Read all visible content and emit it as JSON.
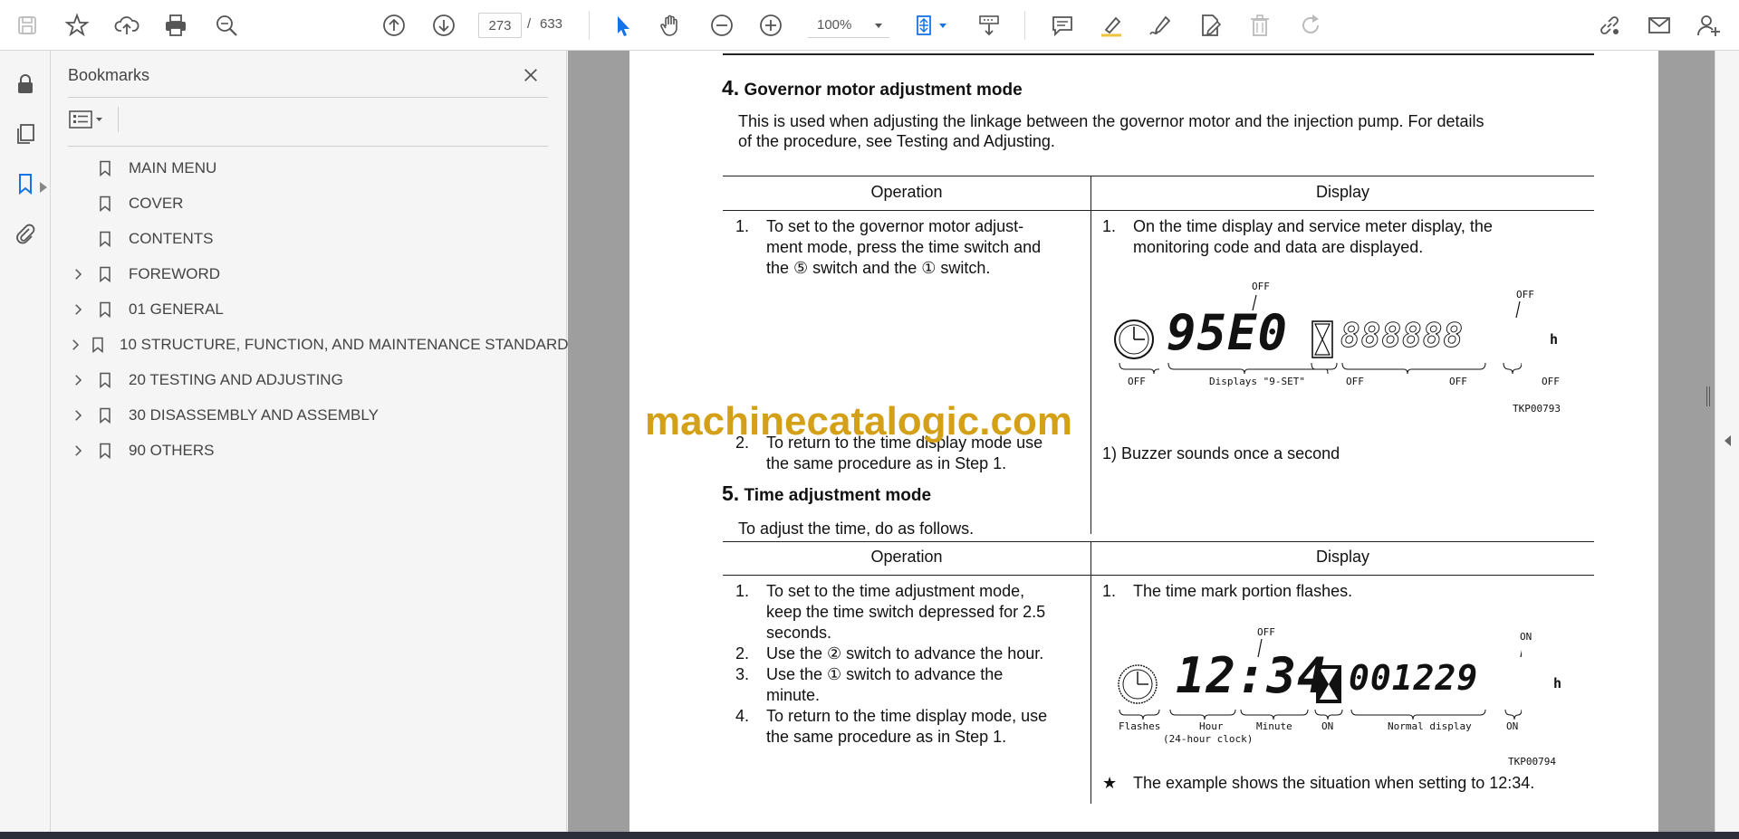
{
  "toolbar": {
    "page_current": "273",
    "page_separator": "/",
    "page_total": "633",
    "zoom": "100%"
  },
  "bookmarks": {
    "title": "Bookmarks",
    "items": [
      {
        "label": "MAIN MENU",
        "expandable": false
      },
      {
        "label": "COVER",
        "expandable": false
      },
      {
        "label": "CONTENTS",
        "expandable": false
      },
      {
        "label": "FOREWORD",
        "expandable": true
      },
      {
        "label": "01 GENERAL",
        "expandable": true
      },
      {
        "label": "10 STRUCTURE, FUNCTION, AND MAINTENANCE STANDARD",
        "expandable": true
      },
      {
        "label": "20 TESTING AND ADJUSTING",
        "expandable": true
      },
      {
        "label": "30 DISASSEMBLY AND ASSEMBLY",
        "expandable": true
      },
      {
        "label": "90 OTHERS",
        "expandable": true
      }
    ]
  },
  "document": {
    "section4": {
      "number": "4.",
      "title": "Governor motor adjustment mode",
      "intro_line1": "This is used when adjusting the linkage between the governor motor and the injection pump. For details",
      "intro_line2": "of the procedure, see Testing and Adjusting.",
      "col_operation": "Operation",
      "col_display": "Display",
      "op1_num": "1.",
      "op1_l1": "To set to the governor motor adjust-",
      "op1_l2": "ment mode, press the time switch and",
      "op1_l3": "the ⑤ switch and the ① switch.",
      "op2_num": "2.",
      "op2_l1": "To return to the time display mode use",
      "op2_l2": "the same procedure as in Step 1.",
      "disp1_num": "1.",
      "disp1_l1": "On the time display and service meter display, the",
      "disp1_l2": "monitoring code and data are displayed.",
      "disp_note": "1)  Buzzer sounds once a second",
      "fig": {
        "off_top1": "OFF",
        "off_top2": "OFF",
        "digits": "95E0",
        "meter": "888888",
        "unit": "h",
        "lbl_off1": "OFF",
        "lbl_displays": "Displays \"9-SET\"",
        "lbl_off2": "OFF",
        "lbl_off3": "OFF",
        "lbl_off4": "OFF",
        "code": "TKP00793"
      }
    },
    "section5": {
      "number": "5.",
      "title": "Time adjustment mode",
      "intro": "To adjust the time, do as follows.",
      "col_operation": "Operation",
      "col_display": "Display",
      "op1_num": "1.",
      "op1_l1": "To set to the time adjustment mode,",
      "op1_l2": "keep the time switch depressed for 2.5",
      "op1_l3": "seconds.",
      "op2_num": "2.",
      "op2_l1": "Use the ② switch to advance the hour.",
      "op3_num": "3.",
      "op3_l1": "Use the ① switch to advance the",
      "op3_l2": "minute.",
      "op4_num": "4.",
      "op4_l1": "To return to the time display mode, use",
      "op4_l2": "the same procedure as in Step 1.",
      "disp1_num": "1.",
      "disp1_l1": "The time mark portion flashes.",
      "star": "★",
      "star_note": "The example shows the situation when setting to 12:34.",
      "fig": {
        "off_top": "OFF",
        "on_top": "ON",
        "digits": "12:34",
        "meter": "001229",
        "unit": "h",
        "lbl_flashes": "Flashes",
        "lbl_hour": "Hour",
        "lbl_24": "(24-hour clock)",
        "lbl_minute": "Minute",
        "lbl_on1": "ON",
        "lbl_normal": "Normal display",
        "lbl_on2": "ON",
        "code": "TKP00794"
      }
    },
    "watermark": "machinecatalogic.com"
  },
  "colors": {
    "accent_blue": "#1473e6",
    "watermark": "#d4a017"
  }
}
